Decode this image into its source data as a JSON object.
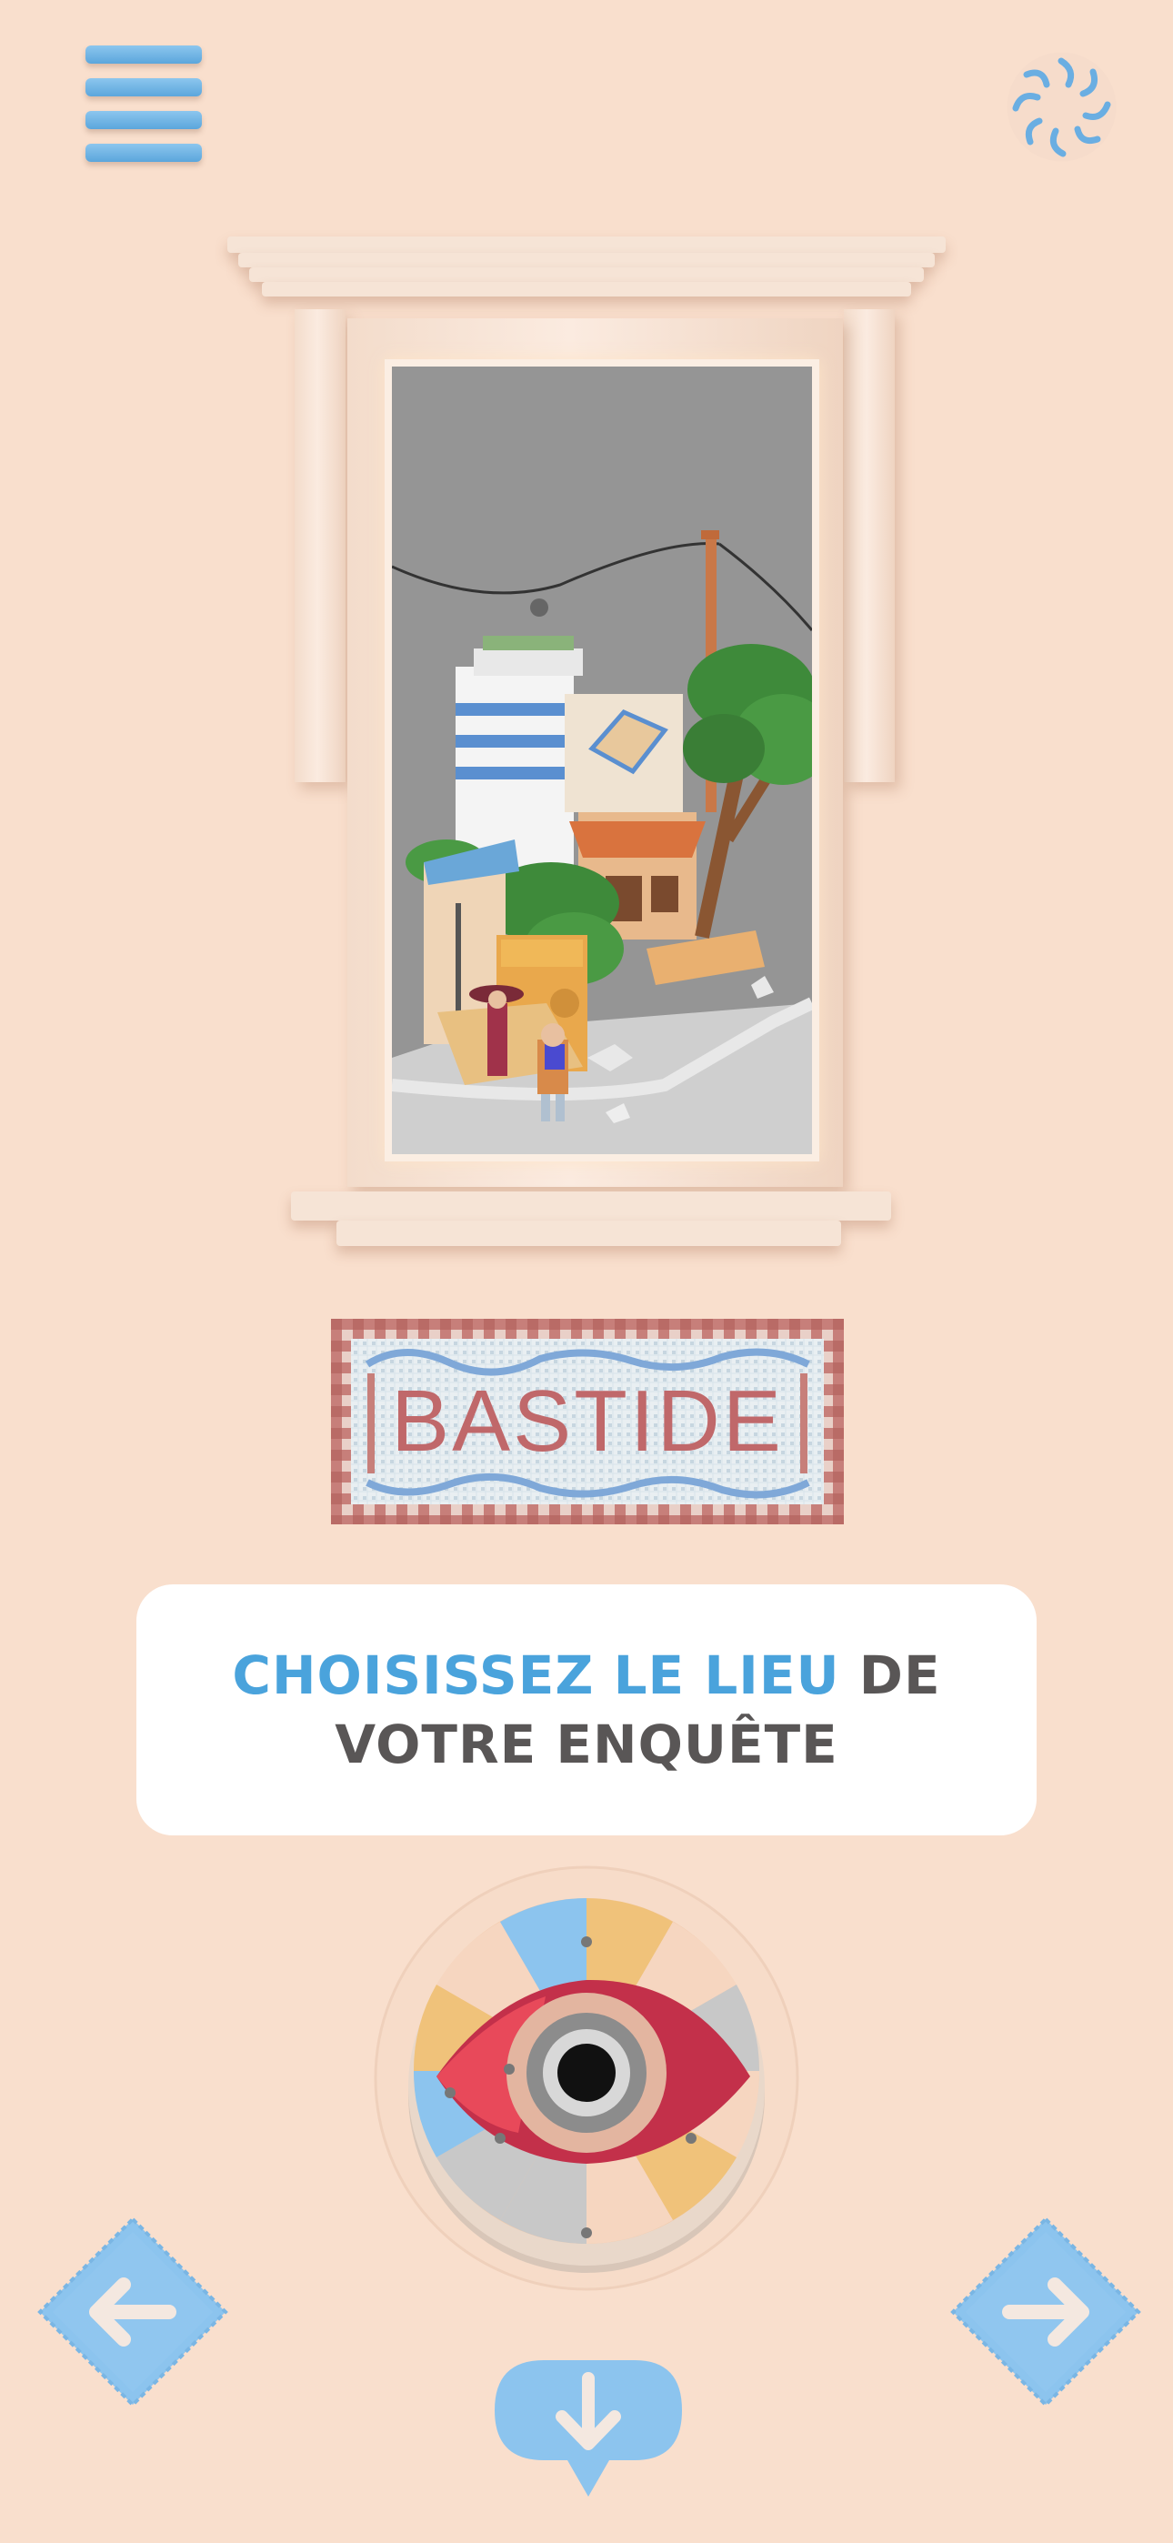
{
  "header": {
    "menu_icon": "hamburger-menu-icon",
    "settings_icon": "swirl-settings-icon"
  },
  "location": {
    "sign_text": "BASTIDE"
  },
  "prompt": {
    "highlight": "CHOISISSEZ LE LIEU",
    "line1_rest": " DE",
    "line2": "VOTRE ENQUÊTE"
  },
  "colors": {
    "background": "#f9dfcd",
    "accent_blue": "#4aa3dc",
    "text_gray": "#595656",
    "eye_red": "#c3304a"
  },
  "nav": {
    "prev_icon": "arrow-left-icon",
    "next_icon": "arrow-right-icon",
    "down_icon": "arrow-down-icon"
  }
}
